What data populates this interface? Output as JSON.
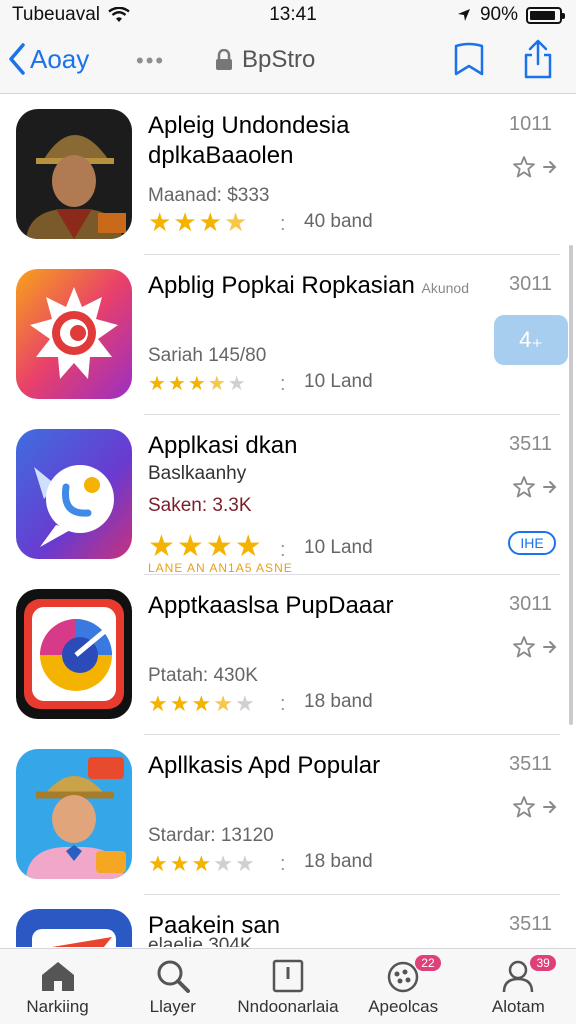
{
  "status_bar": {
    "carrier": "Tubeuaval",
    "time": "13:41",
    "battery": "90%",
    "battery_level": 0.9
  },
  "nav": {
    "back_label": "Aoay",
    "dots": "•••",
    "title": "BpStro"
  },
  "apps": [
    {
      "title": "Apleig Undondesia dplkaBaaolen",
      "sub": "Maanad: $333",
      "rating_count": "40 band",
      "rank": "1011",
      "stars": 4
    },
    {
      "title": "Apblig Popkai Ropkasian",
      "title_suffix": "Akunod",
      "sub": "Sariah 145/80",
      "rating_count": "10 Land",
      "rank": "3011",
      "button": "4₊",
      "stars": 3.5
    },
    {
      "title": "Applkasi dkan",
      "line2": "Baslkaanhy",
      "sub": "Saken: 3.3K",
      "rating_count": "10 Land",
      "rank": "3511",
      "pill": "IHE",
      "promo": "LANE  AN  AN1A5  ASNE",
      "stars": 4
    },
    {
      "title": "Apptkaaslsa PupDaaar",
      "sub": "Ptatah: 430K",
      "rating_count": "18 band",
      "rank": "3011",
      "stars": 3.5
    },
    {
      "title": "Apllkasis Apd Popular",
      "sub": "Stardar: 13120",
      "rating_count": "18 band",
      "rank": "3511",
      "stars": 3
    },
    {
      "title": "Paakein san",
      "sub": "elaelie 304K",
      "rank": "3511"
    }
  ],
  "tabs": [
    {
      "label": "Narkiing",
      "icon": "home-icon"
    },
    {
      "label": "Llayer",
      "icon": "search-icon"
    },
    {
      "label": "Nndoonarlaia",
      "icon": "door-icon"
    },
    {
      "label": "Apeolcas",
      "icon": "apps-icon",
      "badge": "22"
    },
    {
      "label": "Alotam",
      "icon": "person-icon",
      "badge": "39"
    }
  ],
  "colors": {
    "accent": "#1a73e8",
    "star": "#f5b301",
    "badge": "#e0407a"
  }
}
